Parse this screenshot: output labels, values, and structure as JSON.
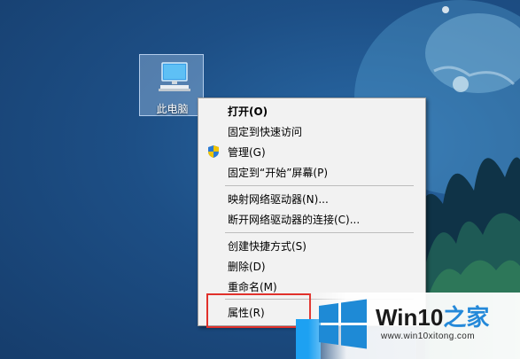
{
  "desktop": {
    "icon_label": "此电脑",
    "icon_name": "computer-icon"
  },
  "context_menu": {
    "items": [
      {
        "label": "打开(O)",
        "bold": true
      },
      {
        "label": "固定到快速访问"
      },
      {
        "label": "管理(G)",
        "icon": "uac-shield-icon"
      },
      {
        "label": "固定到“开始”屏幕(P)"
      },
      {
        "label": "映射网络驱动器(N)..."
      },
      {
        "label": "断开网络驱动器的连接(C)..."
      },
      {
        "label": "创建快捷方式(S)"
      },
      {
        "label": "删除(D)"
      },
      {
        "label": "重命名(M)"
      },
      {
        "label": "属性(R)"
      }
    ],
    "highlighted_item": "属性(R)",
    "highlight_color": "#e1312b"
  },
  "watermark": {
    "title_main": "Win10",
    "title_accent": "之家",
    "subtitle": "www.win10xitong.com",
    "accent_color": "#2489d9"
  }
}
